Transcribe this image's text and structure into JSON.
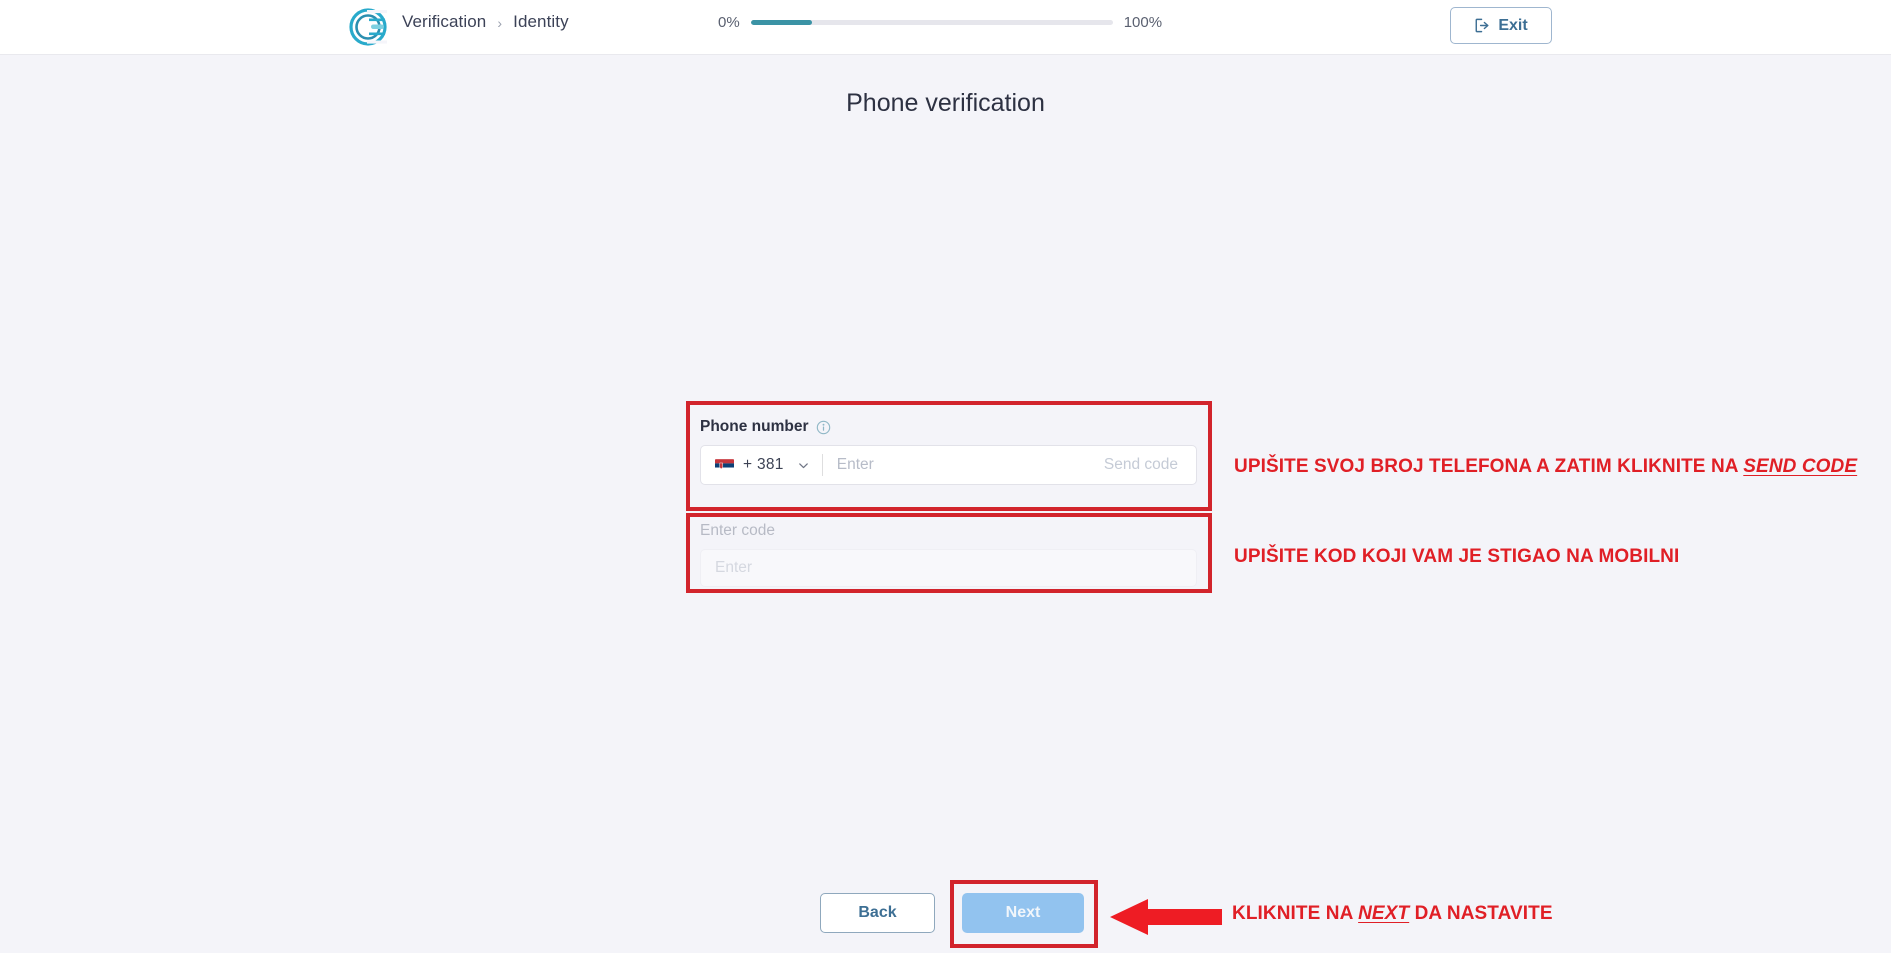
{
  "header": {
    "logo_icon": "circular-c-logo-icon",
    "breadcrumb": {
      "root": "Verification",
      "separator": "›",
      "current": "Identity"
    },
    "progress": {
      "min_label": "0%",
      "max_label": "100%",
      "value_percent": 17,
      "fill_color": "#3b93a5",
      "track_color": "#e6e6ec"
    },
    "exit": {
      "label": "Exit",
      "icon": "exit-arrow-icon",
      "border_color": "#9fb6cf",
      "text_color": "#3d6f94"
    }
  },
  "main": {
    "title": "Phone verification",
    "phone_field": {
      "label": "Phone number",
      "info_icon": "info-circle-icon",
      "flag_icon": "serbia-flag-icon",
      "dial_code": "+ 381",
      "chevron_icon": "chevron-down-icon",
      "input_placeholder": "Enter",
      "input_value": "",
      "send_code_label": "Send code"
    },
    "code_field": {
      "label": "Enter code",
      "input_placeholder": "Enter",
      "input_value": "",
      "disabled": true
    }
  },
  "footer": {
    "back_label": "Back",
    "next_label": "Next",
    "next_disabled": true,
    "next_bg_color": "#92c3ef"
  },
  "annotations": {
    "color": "#e01f26",
    "phone": {
      "prefix": "UPIŠITE SVOJ BROJ TELEFONA A ZATIM KLIKNITE NA ",
      "emphasis": "SEND CODE"
    },
    "code": {
      "text": "UPIŠITE KOD KOJI VAM JE STIGAO NA MOBILNI"
    },
    "next": {
      "prefix": "KLIKNITE NA ",
      "emphasis": "NEXT",
      "suffix": " DA NASTAVITE"
    },
    "arrow_icon": "left-arrow-icon",
    "boxes": [
      "phone-field-highlight",
      "code-field-highlight",
      "next-button-highlight"
    ]
  }
}
